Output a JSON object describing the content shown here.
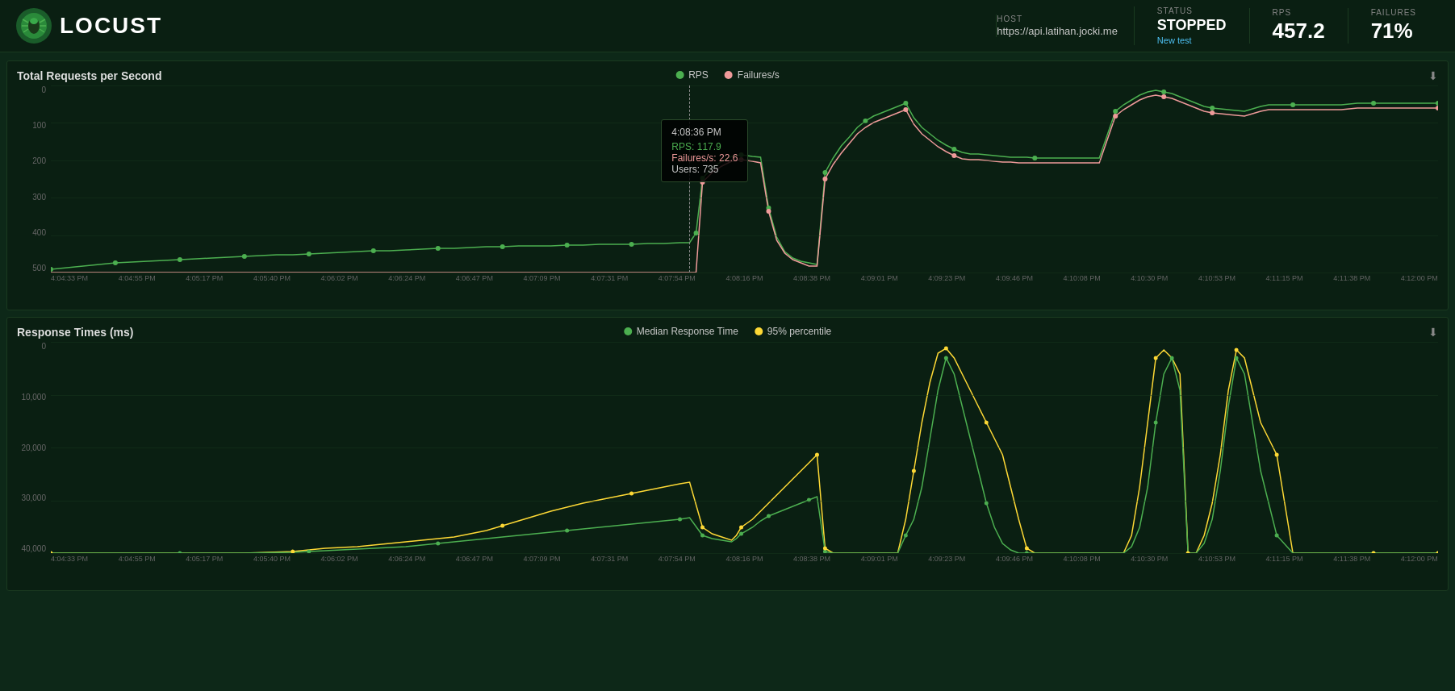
{
  "header": {
    "logo_text": "LOCUST",
    "host_label": "HOST",
    "host_value": "https://api.latihan.jocki.me",
    "status_label": "STATUS",
    "status_value": "STOPPED",
    "new_test_label": "New test",
    "rps_label": "RPS",
    "rps_value": "457.2",
    "failures_label": "FAILURES",
    "failures_value": "71%"
  },
  "chart1": {
    "title": "Total Requests per Second",
    "legend_rps": "RPS",
    "legend_failures": "Failures/s",
    "rps_color": "#4caf50",
    "failures_color": "#ef9a9a",
    "y_labels": [
      "0",
      "100",
      "200",
      "300",
      "400",
      "500"
    ],
    "x_labels": [
      "4:04:33 PM",
      "4:04:55 PM",
      "4:05:17 PM",
      "4:05:40 PM",
      "4:06:02 PM",
      "4:06:24 PM",
      "4:06:47 PM",
      "4:07:09 PM",
      "4:07:31 PM",
      "4:07:54 PM",
      "4:08:16 PM",
      "4:08:38 PM",
      "4:09:01 PM",
      "4:09:23 PM",
      "4:09:46 PM",
      "4:10:08 PM",
      "4:10:30 PM",
      "4:10:53 PM",
      "4:11:15 PM",
      "4:11:38 PM",
      "4:12:00 PM"
    ],
    "tooltip": {
      "time": "4:08:36 PM",
      "rps_label": "RPS:",
      "rps_value": "117.9",
      "failures_label": "Failures/s:",
      "failures_value": "22.6",
      "users_label": "Users:",
      "users_value": "735"
    }
  },
  "chart2": {
    "title": "Response Times (ms)",
    "legend_median": "Median Response Time",
    "legend_p95": "95% percentile",
    "median_color": "#4caf50",
    "p95_color": "#fdd835",
    "y_labels": [
      "0",
      "10,000",
      "20,000",
      "30,000",
      "40,000"
    ],
    "x_labels": [
      "4:04:33 PM",
      "4:04:55 PM",
      "4:05:17 PM",
      "4:05:40 PM",
      "4:06:02 PM",
      "4:06:24 PM",
      "4:06:47 PM",
      "4:07:09 PM",
      "4:07:31 PM",
      "4:07:54 PM",
      "4:08:16 PM",
      "4:08:38 PM",
      "4:09:01 PM",
      "4:09:23 PM",
      "4:09:46 PM",
      "4:10:08 PM",
      "4:10:30 PM",
      "4:10:53 PM",
      "4:11:15 PM",
      "4:11:38 PM",
      "4:12:00 PM"
    ]
  },
  "download_icon": "⬇"
}
